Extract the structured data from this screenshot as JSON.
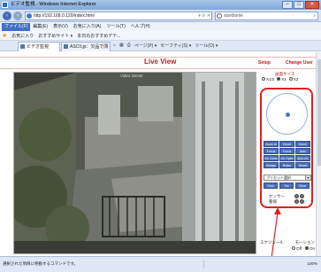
{
  "browser": {
    "title": "ビデオ監視 - Windows Internet Explorer",
    "url": "http://192.168.0.120/index.html",
    "search_placeholder": "startbonie",
    "menu": [
      "ファイル(F)",
      "編集(E)",
      "表示(V)",
      "お気に入り(A)",
      "ツール(T)",
      "ヘルプ(H)"
    ],
    "favorites": [
      "お気に入り",
      "おすすめサイト ▾",
      "本日のおすすめデテ..."
    ],
    "tabs": [
      {
        "label": "ビデオ監視",
        "active": true
      },
      {
        "label": "ASCII.jp：欠品で同期が...",
        "active": false
      }
    ],
    "toolbar_right": [
      "ページ(P) ▾",
      "セーフティ(S) ▾",
      "ツール(O) ▾"
    ],
    "status_text": "選択された項目に移動するコマンドです。",
    "zoom": "100%"
  },
  "page": {
    "title": "Live View",
    "setup_link": "Setup",
    "change_user_link": "Change User",
    "video_label": "Video Server",
    "screen_size": {
      "title": "画面サイズ",
      "options": [
        {
          "label": "X1/2",
          "selected": false
        },
        {
          "label": "X1",
          "selected": true
        },
        {
          "label": "X2",
          "selected": false
        }
      ]
    },
    "ptz_buttons": [
      "Zoom In",
      "Zoom Out",
      "Home",
      "Focus Near",
      "Focus Far",
      "Auto Focus",
      "Iris Close",
      "Iris Open",
      "Auto Iris",
      "Always On",
      "Brake",
      "Reset"
    ],
    "preset": {
      "select_value": "プリセット選択",
      "buttons": [
        "Goto",
        "Set",
        "Clear"
      ]
    },
    "sensor_labels": [
      "センサー",
      "警報"
    ],
    "status_labels": [
      "スケジュール",
      "モーション"
    ],
    "status_values": [
      "Off",
      "On"
    ]
  }
}
